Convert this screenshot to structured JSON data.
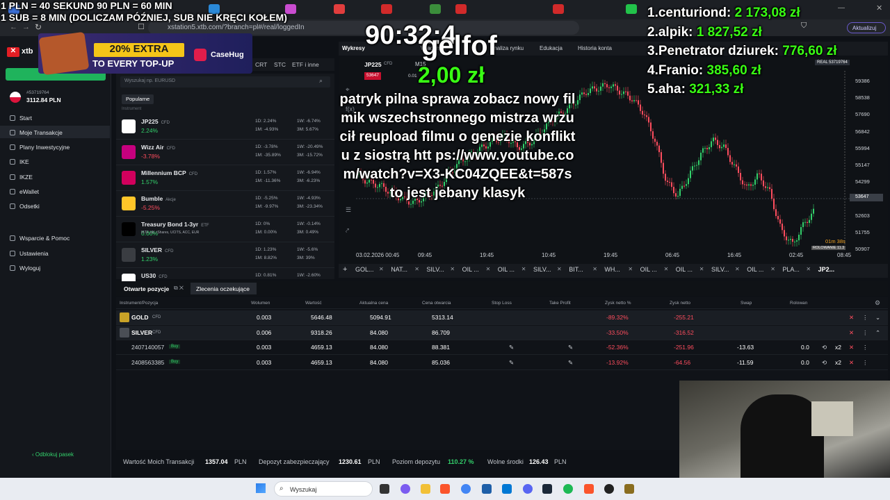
{
  "stream_header": {
    "line1": "1 PLN = 40 SEKUND 90 PLN = 60 MIN",
    "line2": "1 SUB = 8 MIN (DOLICZAM PÓŹNIEJ, SUB NIE KRĘCI KOŁEM)",
    "timer": "90:32:4",
    "donor": "gelfof",
    "donation_amount": "2,00 zł",
    "donation_message": "patryk pilna sprawa zobacz nowy filmik wszechstronnego mistrza wrzucił reupload filmu o genezie konfliktu z siostrą htt ps://www.youtube.com/watch?v=X3-KC04ZQEE&t=587s to jest jebany klasyk"
  },
  "leaderboard": [
    {
      "rank": "1.",
      "name": "centuriond:",
      "amount": "2 173,08 zł"
    },
    {
      "rank": "2.",
      "name": "alpik:",
      "amount": "1 827,52 zł"
    },
    {
      "rank": "3.",
      "name": "Penetrator dziurek:",
      "amount": "776,60 zł"
    },
    {
      "rank": "4.",
      "name": "Franio:",
      "amount": "385,60 zł"
    },
    {
      "rank": "5.",
      "name": "aha:",
      "amount": "321,33 zł"
    }
  ],
  "ad": {
    "headline": "20% EXTRA",
    "sub": "TO EVERY TOP-UP",
    "brand": "CaseHug"
  },
  "browser": {
    "url": "xstation5.xtb.com/?branch=pl#/real/loggedIn",
    "update_button": "Aktualizuj"
  },
  "app": {
    "logo": "xtb",
    "account_number": "#53719764",
    "balance": "3112.84 PLN",
    "nav": [
      "Start",
      "Moje Transakcje",
      "Plany Inwestycyjne",
      "IKE",
      "IKZE",
      "eWallet",
      "Odsetki"
    ],
    "nav_secondary": [
      "Wsparcie & Pomoc",
      "Ustawienia",
      "Wyloguj"
    ],
    "unlock_bar": "Odblokuj pasek"
  },
  "instruments": {
    "categories": [
      "CRT",
      "STC",
      "ETF i inne"
    ],
    "search_placeholder": "Wyszukaj np. EURUSD",
    "tab": "Popularne",
    "section_label": "Instrument",
    "rows": [
      {
        "name": "JP225",
        "type": "CFD",
        "change": "2.24%",
        "d1": "1D: 2.24%",
        "w1": "1W: -6.74%",
        "m1": "1M: -4.93%",
        "m3": "3M: 5.67%",
        "logo_color": "#ffffff",
        "trend": "up"
      },
      {
        "name": "Wizz Air",
        "type": "CFD",
        "change": "-3.78%",
        "d1": "1D: -3.78%",
        "w1": "1W: -20.49%",
        "m1": "1M: -35.89%",
        "m3": "3M: -15.72%",
        "logo_color": "#c6007e",
        "trend": "down"
      },
      {
        "name": "Millennium BCP",
        "type": "CFD",
        "change": "1.57%",
        "d1": "1D: 1.57%",
        "w1": "1W: -6.94%",
        "m1": "1M: -11.36%",
        "m3": "3M: -6.23%",
        "logo_color": "#d1005d",
        "trend": "up"
      },
      {
        "name": "Bumble",
        "type": "Akcje",
        "change": "-5.25%",
        "d1": "1D: -5.25%",
        "w1": "1W: -4.93%",
        "m1": "1M: -9.97%",
        "m3": "3M: -23.34%",
        "logo_color": "#ffc629",
        "trend": "down"
      },
      {
        "name": "Treasury Bond 1-3yr",
        "type": "ETF",
        "change": "0.00%",
        "subtitle": "IBTE UK, iShares, UCITS, ACC, EUR",
        "d1": "1D: 0%",
        "w1": "1W: -0.14%",
        "m1": "1M: 0.00%",
        "m3": "3M: 0.49%",
        "logo_color": "#000000",
        "trend": "up"
      },
      {
        "name": "SILVER",
        "type": "CFD",
        "change": "1.23%",
        "d1": "1D: 1.23%",
        "w1": "1W: -5.6%",
        "m1": "1M: 8.82%",
        "m3": "3M: 39%",
        "logo_color": "#3a3d42",
        "trend": "up"
      },
      {
        "name": "US30",
        "type": "CFD",
        "change": "",
        "d1": "1D: 0.81%",
        "w1": "1W: -2.60%",
        "m1": "",
        "m3": "",
        "logo_color": "#ffffff",
        "trend": "up"
      }
    ]
  },
  "chart": {
    "top_tabs": [
      "Wykresy",
      "Wiadom...",
      "Analiza rynku",
      "Edukacja",
      "Historia konta"
    ],
    "symbol": "JP225",
    "symbol_type": "CFD",
    "timeframe": "M15",
    "bid_price": "53647",
    "spread": "0.01",
    "account_badge": "REAL 53719764",
    "price_ticks": [
      "59386",
      "58538",
      "57690",
      "56842",
      "55994",
      "55147",
      "54299",
      "53647",
      "52603",
      "51755",
      "50907"
    ],
    "time_ticks": [
      "03.02.2026 00:45",
      "09:45",
      "19:45",
      "10:45",
      "19:45",
      "06:45",
      "16:45",
      "02:45",
      "08:45"
    ],
    "countdown": "01m 38s",
    "rollover": "ROLOWANIE 11.3"
  },
  "chart_tabs": [
    "GOL...",
    "NAT...",
    "SILV...",
    "OIL ...",
    "OIL ...",
    "SILV...",
    "BIT...",
    "WH...",
    "OIL ...",
    "OIL ...",
    "SILV...",
    "OIL ...",
    "PLA...",
    "JP2..."
  ],
  "positions": {
    "tab_open": "Otwarte pozycje",
    "tab_pending": "Zlecenia oczekujące",
    "headers": [
      "Instrument/Pozycja",
      "Wolumen",
      "Wartość",
      "Aktualna cena",
      "Cena otwarcia",
      "Stop Loss",
      "Take Profit",
      "Zysk netto %",
      "Zysk netto",
      "Swap",
      "Rolowan"
    ],
    "rows": [
      {
        "instrument": "GOLD",
        "type": "CFD",
        "volume": "0.003",
        "value": "5646.48",
        "price": "5094.91",
        "open": "5313.14",
        "profit_pct": "-89.32%",
        "profit": "-255.21",
        "swap": "",
        "rollover": "",
        "group": true
      },
      {
        "instrument": "SILVER",
        "type": "CFD",
        "volume": "0.006",
        "value": "9318.26",
        "price": "84.080",
        "open": "86.709",
        "profit_pct": "-33.50%",
        "profit": "-316.52",
        "swap": "",
        "rollover": "",
        "group": true
      },
      {
        "instrument": "2407140057",
        "type": "Buy",
        "volume": "0.003",
        "value": "4659.13",
        "price": "84.080",
        "open": "88.381",
        "profit_pct": "-52.36%",
        "profit": "-251.96",
        "swap": "-13.63",
        "rollover": "0.0",
        "group": false,
        "multiplier": "x2"
      },
      {
        "instrument": "2408563385",
        "type": "Buy",
        "volume": "0.003",
        "value": "4659.13",
        "price": "84.080",
        "open": "85.036",
        "profit_pct": "-13.92%",
        "profit": "-64.56",
        "swap": "-11.59",
        "rollover": "0.0",
        "group": false,
        "multiplier": "x2"
      }
    ]
  },
  "footer": {
    "l1": "Wartość Moich Transakcji",
    "v1": "1357.04",
    "u1": "PLN",
    "l2": "Depozyt zabezpieczający",
    "v2": "1230.61",
    "u2": "PLN",
    "l3": "Poziom depozytu",
    "v3": "110.27 %",
    "l4": "Wolne środki",
    "v4": "126.43",
    "u4": "PLN"
  },
  "taskbar": {
    "search": "Wyszukaj"
  },
  "colors": {
    "green": "#33d06b",
    "red": "#ff4d5e",
    "accent": "#1fb35c",
    "xtb_red": "#e31e24",
    "overlay_green": "#39ff14"
  }
}
